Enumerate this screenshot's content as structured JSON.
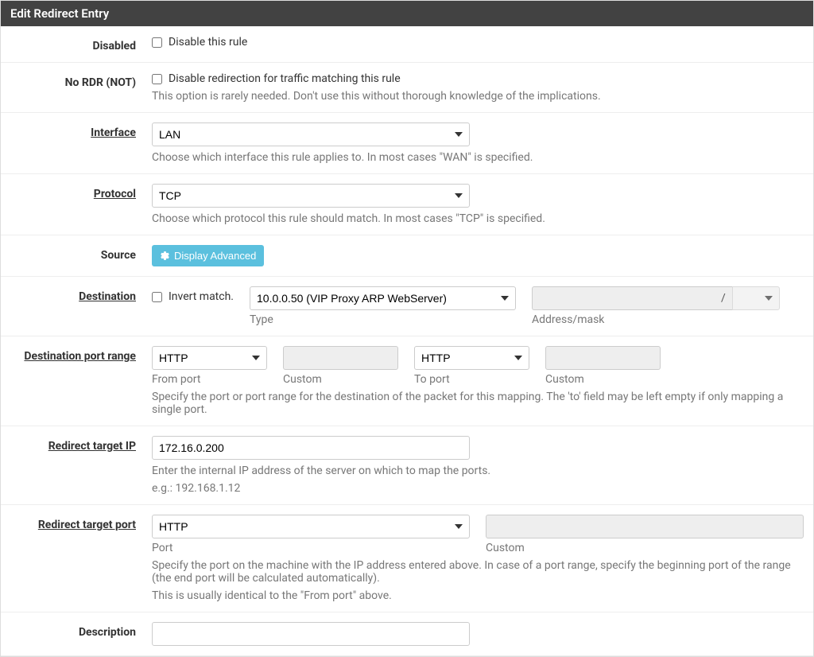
{
  "panel": {
    "title": "Edit Redirect Entry"
  },
  "disabled": {
    "label": "Disabled",
    "checkbox_label": "Disable this rule"
  },
  "nordr": {
    "label": "No RDR (NOT)",
    "checkbox_label": "Disable redirection for traffic matching this rule",
    "help": "This option is rarely needed. Don't use this without thorough knowledge of the implications."
  },
  "interface_field": {
    "label": "Interface",
    "value": "LAN",
    "help": "Choose which interface this rule applies to. In most cases \"WAN\" is specified."
  },
  "protocol": {
    "label": "Protocol",
    "value": "TCP",
    "help": "Choose which protocol this rule should match. In most cases \"TCP\" is specified."
  },
  "source": {
    "label": "Source",
    "button": "Display Advanced"
  },
  "destination": {
    "label": "Destination",
    "invert_label": "Invert match.",
    "type_value": "10.0.0.50 (VIP Proxy ARP WebServer)",
    "type_sublabel": "Type",
    "slash": "/",
    "mask_sublabel": "Address/mask"
  },
  "dest_port": {
    "label": "Destination port range",
    "from_value": "HTTP",
    "from_sublabel": "From port",
    "from_custom_sublabel": "Custom",
    "to_value": "HTTP",
    "to_sublabel": "To port",
    "to_custom_sublabel": "Custom",
    "help": "Specify the port or port range for the destination of the packet for this mapping. The 'to' field may be left empty if only mapping a single port."
  },
  "redir_ip": {
    "label": "Redirect target IP",
    "value": "172.16.0.200",
    "help1": "Enter the internal IP address of the server on which to map the ports.",
    "help2": "e.g.: 192.168.1.12"
  },
  "redir_port": {
    "label": "Redirect target port",
    "port_value": "HTTP",
    "port_sublabel": "Port",
    "custom_sublabel": "Custom",
    "help1": "Specify the port on the machine with the IP address entered above. In case of a port range, specify the beginning port of the range (the end port will be calculated automatically).",
    "help2": "This is usually identical to the \"From port\" above."
  },
  "description": {
    "label": "Description"
  }
}
